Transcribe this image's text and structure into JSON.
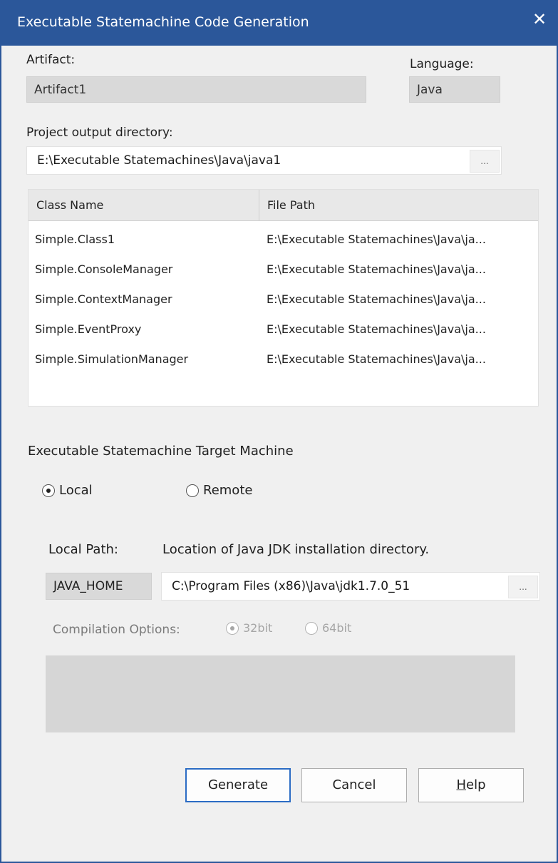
{
  "window": {
    "title": "Executable Statemachine Code Generation",
    "close_icon": "close-icon"
  },
  "artifact": {
    "label": "Artifact:",
    "value": "Artifact1"
  },
  "language": {
    "label": "Language:",
    "value": "Java"
  },
  "output_dir": {
    "label": "Project output directory:",
    "value": "E:\\Executable Statemachines\\Java\\java1",
    "browse_label": "..."
  },
  "table": {
    "columns": [
      "Class Name",
      "File Path"
    ],
    "rows": [
      [
        "Simple.Class1",
        "E:\\Executable Statemachines\\Java\\ja..."
      ],
      [
        "Simple.ConsoleManager",
        "E:\\Executable Statemachines\\Java\\ja..."
      ],
      [
        "Simple.ContextManager",
        "E:\\Executable Statemachines\\Java\\ja..."
      ],
      [
        "Simple.EventProxy",
        "E:\\Executable Statemachines\\Java\\ja..."
      ],
      [
        "Simple.SimulationManager",
        "E:\\Executable Statemachines\\Java\\ja..."
      ]
    ]
  },
  "target": {
    "heading": "Executable Statemachine Target Machine",
    "options": [
      {
        "label": "Local",
        "selected": true
      },
      {
        "label": "Remote",
        "selected": false
      }
    ]
  },
  "local_path": {
    "label": "Local Path:",
    "description": "Location of Java JDK installation directory.",
    "variable": "JAVA_HOME",
    "value": "C:\\Program Files (x86)\\Java\\jdk1.7.0_51",
    "browse_label": "..."
  },
  "compilation": {
    "label": "Compilation Options:",
    "options": [
      {
        "label": "32bit",
        "selected": true,
        "enabled": false
      },
      {
        "label": "64bit",
        "selected": false,
        "enabled": false
      }
    ]
  },
  "buttons": {
    "generate": "Generate",
    "cancel": "Cancel",
    "help_prefix": "",
    "help_mnemonic": "H",
    "help_rest": "elp"
  }
}
